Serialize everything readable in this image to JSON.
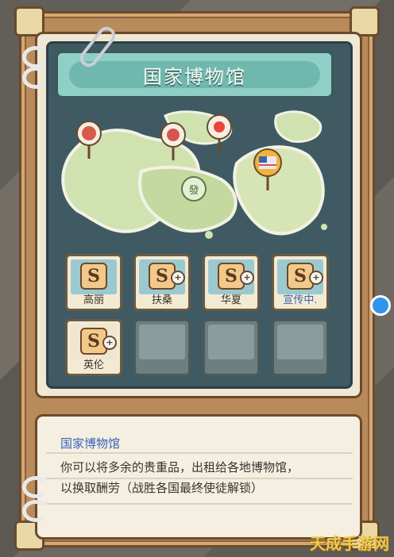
{
  "title": "国家博物馆",
  "cards": [
    {
      "label": "高丽",
      "badge": "S",
      "plus": false,
      "highlight": false,
      "locked": false
    },
    {
      "label": "扶桑",
      "badge": "S",
      "plus": true,
      "highlight": false,
      "locked": false
    },
    {
      "label": "华夏",
      "badge": "S",
      "plus": true,
      "highlight": false,
      "locked": false
    },
    {
      "label": "宣传中.",
      "badge": "S",
      "plus": true,
      "highlight": true,
      "locked": false
    },
    {
      "label": "英伦",
      "badge": "S",
      "plus": true,
      "highlight": false,
      "locked": false
    },
    {
      "label": "",
      "badge": "",
      "plus": false,
      "highlight": false,
      "locked": true
    },
    {
      "label": "",
      "badge": "",
      "plus": false,
      "highlight": false,
      "locked": true
    },
    {
      "label": "",
      "badge": "",
      "plus": false,
      "highlight": false,
      "locked": true
    }
  ],
  "description": {
    "title": "国家博物馆",
    "line1": "你可以将多余的贵重品，出租给各地博物馆，",
    "line2": "以换取酬劳（战胜各国最终使徒解锁）"
  },
  "map_pin_text": "發",
  "watermark": "天成手游网",
  "colors": {
    "accent_blue": "#3a62b5",
    "banner": "#8fcfc6",
    "frame_wood": "#b98a5a"
  }
}
